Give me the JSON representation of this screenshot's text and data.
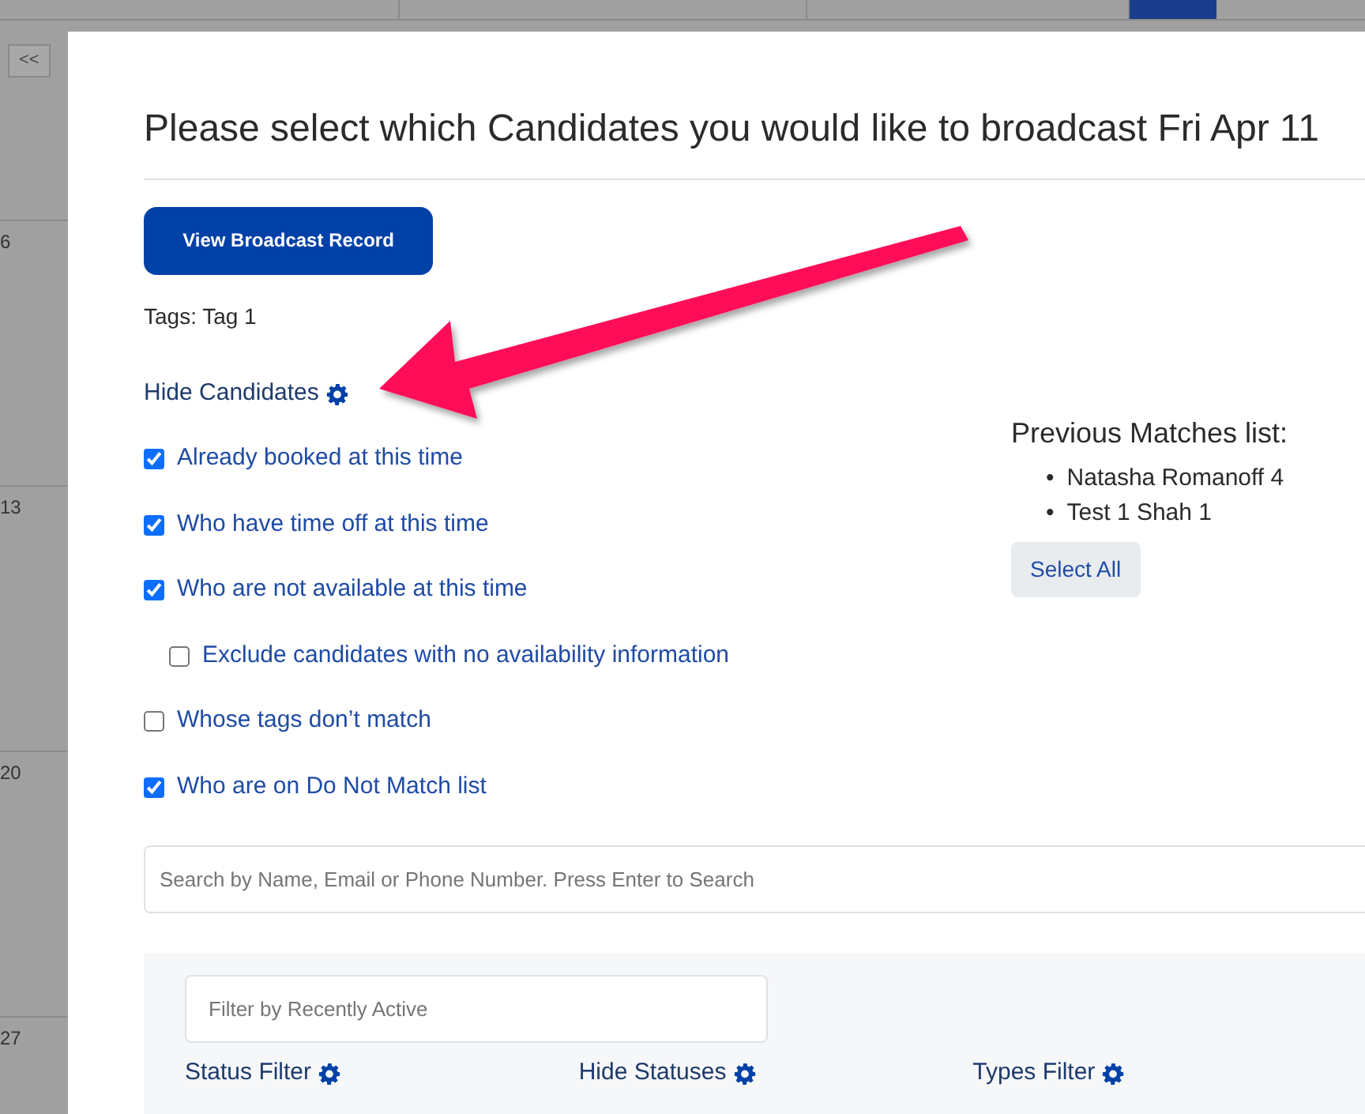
{
  "backdrop": {
    "nav_button": "<<",
    "day_numbers": [
      "6",
      "13",
      "20",
      "27"
    ]
  },
  "modal": {
    "title": "Please select which Candidates you would like to broadcast Fri Apr 11",
    "record_button": "View Broadcast Record",
    "tags": "Tags: Tag 1",
    "hide_candidates": {
      "label": "Hide Candidates",
      "options": [
        {
          "label": "Already booked at this time",
          "checked": true
        },
        {
          "label": "Who have time off at this time",
          "checked": true
        },
        {
          "label": "Who are not available at this time",
          "checked": true,
          "children": [
            {
              "label": "Exclude candidates with no availability information",
              "checked": false
            }
          ]
        },
        {
          "label": "Whose tags don’t match",
          "checked": false
        },
        {
          "label": "Who are on Do Not Match list",
          "checked": true
        }
      ]
    },
    "previous_matches": {
      "title": "Previous Matches list:",
      "items": [
        {
          "bullet": "•",
          "text": "Natasha Romanoff 4"
        },
        {
          "bullet": "•",
          "text": "Test 1 Shah 1"
        }
      ],
      "select_all": "Select All"
    },
    "search": {
      "placeholder": "Search by Name, Email or Phone Number. Press Enter to Search"
    },
    "filters": {
      "recent": {
        "placeholder": "Filter by Recently Active"
      },
      "sections": [
        "Status Filter",
        "Hide Statuses",
        "Types Filter"
      ]
    }
  }
}
